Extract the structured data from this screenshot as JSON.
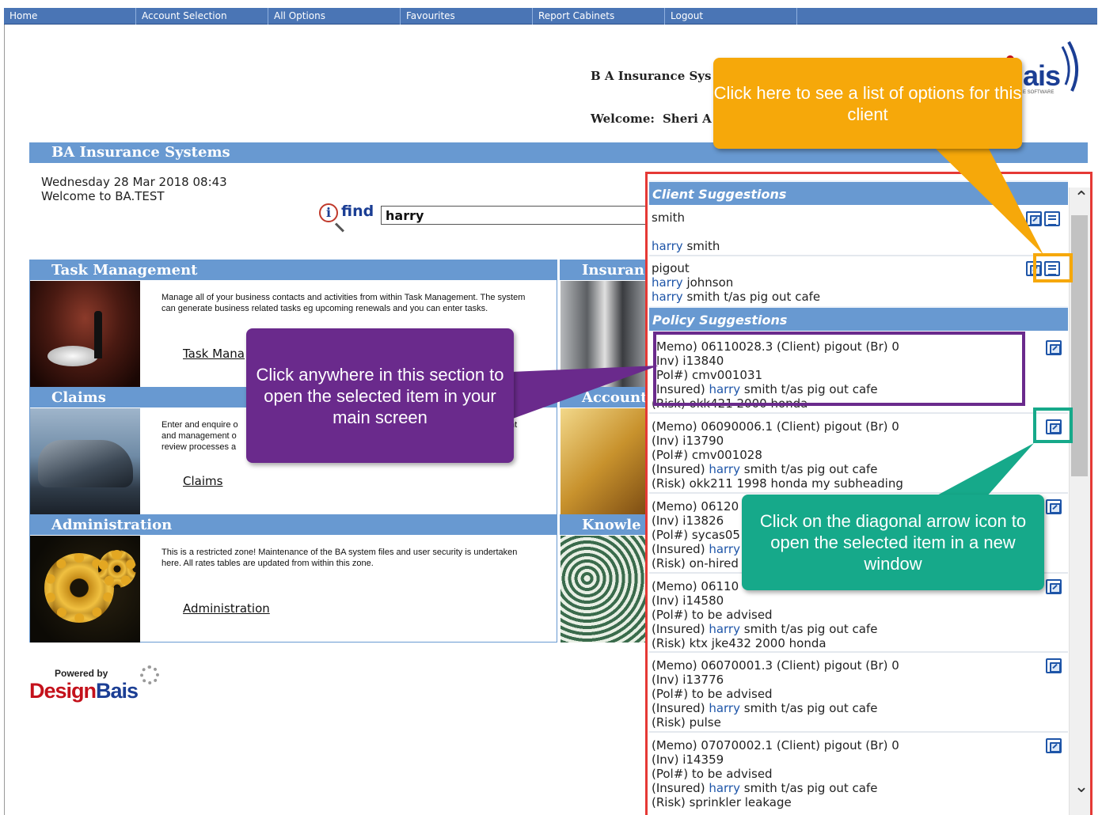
{
  "nav": {
    "items": [
      "Home",
      "Account Selection",
      "All Options",
      "Favourites",
      "Report Cabinets",
      "Logout"
    ]
  },
  "header": {
    "title": "B A Insurance Sys",
    "welcome_label": "Welcome:",
    "user": "Sheri A",
    "logo_text": "ais",
    "logo_sub": "E SOFTWARE"
  },
  "section_title": "BA Insurance Systems",
  "date_line": "Wednesday 28 Mar 2018 08:43",
  "welcome_line": "Welcome to BA.TEST",
  "search": {
    "logo_i": "i",
    "logo_word": "find",
    "value": "harry"
  },
  "modules": {
    "task": {
      "title": "Task Management",
      "desc": "Manage all of your business contacts and activities from within Task Management. The system can generate business related tasks eg upcoming renewals and you can enter tasks.",
      "link": "Task Mana"
    },
    "claims": {
      "title": "Claims",
      "desc": "Enter and enquire o and management o review processes a",
      "link": "Claims",
      "desc_tail": "nt"
    },
    "admin": {
      "title": "Administration",
      "desc": "This is a restricted zone! Maintenance of the BA system files and user security is undertaken here. All rates tables are updated from within this zone.",
      "link": "Administration"
    },
    "insurance": {
      "title": "Insuran"
    },
    "accounts": {
      "title": "Account"
    },
    "knowledge": {
      "title": "Knowle"
    }
  },
  "suggestions": {
    "client_header": "Client Suggestions",
    "client_1": "smith",
    "client_2_hl": "harry",
    "client_2_rest": "smith",
    "client_3": "pigout",
    "client_4_hl": "harry",
    "client_4_rest": "johnson",
    "client_5_hl": "harry",
    "client_5_rest": "smith t/as pig out cafe",
    "policy_header": "Policy Suggestions",
    "p1": {
      "memo": "Memo) 06110028.3 (Client) pigout (Br) 0",
      "inv": "Inv) i13840",
      "pol": "Pol#) cmv001031",
      "ins_label": "Insured)",
      "ins_hl": "harry",
      "ins_rest": "smith t/as pig out cafe",
      "risk": "(Risk) okk421 2000 honda"
    },
    "p2": {
      "memo": "(Memo) 06090006.1 (Client) pigout (Br) 0",
      "inv": "(Inv) i13790",
      "pol": "(Pol#) cmv001028",
      "ins_label": "(Insured)",
      "ins_hl": "harry",
      "ins_rest": "smith t/as pig out cafe",
      "risk": "(Risk) okk211 1998 honda my subheading"
    },
    "p3": {
      "memo": "(Memo) 06120",
      "inv": "(Inv) i13826",
      "pol": "(Pol#) sycas05",
      "ins_label": "(Insured)",
      "ins_hl": "harry",
      "risk": "(Risk) on-hired"
    },
    "p4": {
      "memo": "(Memo) 06110",
      "inv": "(Inv) i14580",
      "pol": "(Pol#) to be advised",
      "ins_label": "(Insured)",
      "ins_hl": "harry",
      "ins_rest": "smith t/as pig out cafe",
      "risk": "(Risk) ktx jke432 2000 honda"
    },
    "p5": {
      "memo": "(Memo) 06070001.3 (Client) pigout (Br) 0",
      "inv": "(Inv) i13776",
      "pol": "(Pol#) to be advised",
      "ins_label": "(Insured)",
      "ins_hl": "harry",
      "ins_rest": "smith t/as pig out cafe",
      "risk": "(Risk) pulse"
    },
    "p6": {
      "memo": "(Memo) 07070002.1 (Client) pigout (Br) 0",
      "inv": "(Inv) i14359",
      "pol": "(Pol#) to be advised",
      "ins_label": "(Insured)",
      "ins_hl": "harry",
      "ins_rest": "smith t/as pig out cafe",
      "risk": "(Risk) sprinkler leakage"
    }
  },
  "callouts": {
    "options": "Click here to see a list of options for this client",
    "section": "Click anywhere in this section to open the selected item in your main screen",
    "arrow": "Click on the diagonal arrow icon to open the selected item in a new window"
  },
  "powered": {
    "small": "Powered by",
    "design": "Design",
    "bais": "Bais"
  },
  "colors": {
    "nav": "#4a75b5",
    "bar": "#6899d1",
    "link_highlight": "#1e55a8",
    "callout_orange": "#f6a80a",
    "callout_purple": "#6a2a8c",
    "callout_teal": "#16a98a",
    "frame_red": "#e53935"
  },
  "icons": {
    "new_window": "open-new-window-icon",
    "options_list": "options-list-icon",
    "find": "find-magnifier-icon"
  }
}
